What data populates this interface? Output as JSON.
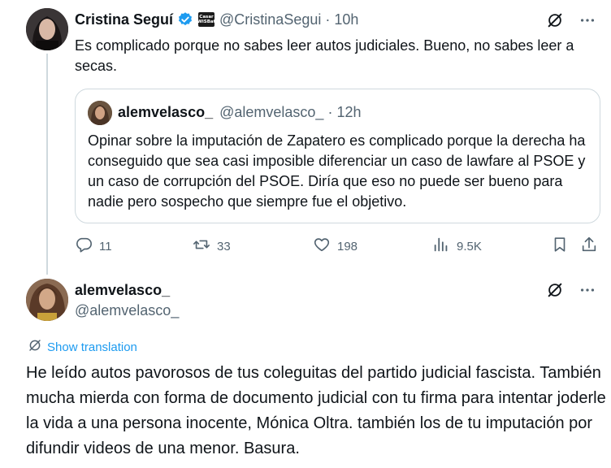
{
  "tweet": {
    "author": {
      "name": "Cristina Seguí",
      "handle": "@CristinaSegui",
      "badge_text": [
        "Casar",
        "WiSBat"
      ]
    },
    "separator": "·",
    "time": "10h",
    "text": "Es complicado porque no sabes leer autos judiciales. Bueno, no sabes leer a secas.",
    "quote": {
      "name": "alemvelasco_",
      "handle": "@alemvelasco_",
      "separator": "·",
      "time": "12h",
      "text": "Opinar sobre la imputación de Zapatero es complicado porque la derecha ha conseguido que sea casi imposible diferenciar un caso de lawfare al PSOE y un caso de corrupción del PSOE. Diría que eso no puede ser bueno para nadie pero sospecho que siempre fue el objetivo."
    },
    "metrics": {
      "replies": "11",
      "reposts": "33",
      "likes": "198",
      "views": "9.5K"
    }
  },
  "reply": {
    "name": "alemvelasco_",
    "handle": "@alemvelasco_",
    "translate_label": "Show translation",
    "text": "He leído autos pavorosos de tus coleguitas del partido judicial fascista. También mucha mierda con forma de documento judicial con tu firma para intentar joderle la vida a una persona inocente, Mónica Oltra. también los de tu imputación por difundir videos de una menor. Basura."
  },
  "icons": {
    "verified": "verified-badge-icon",
    "grok": "grok-icon",
    "more": "more-icon",
    "reply": "reply-icon",
    "repost": "repost-icon",
    "like": "like-icon",
    "views": "views-icon",
    "bookmark": "bookmark-icon",
    "share": "share-icon",
    "globe": "translate-globe-icon"
  },
  "colors": {
    "accent": "#1d9bf0",
    "secondary_text": "#536471",
    "border": "#cfd9de"
  }
}
